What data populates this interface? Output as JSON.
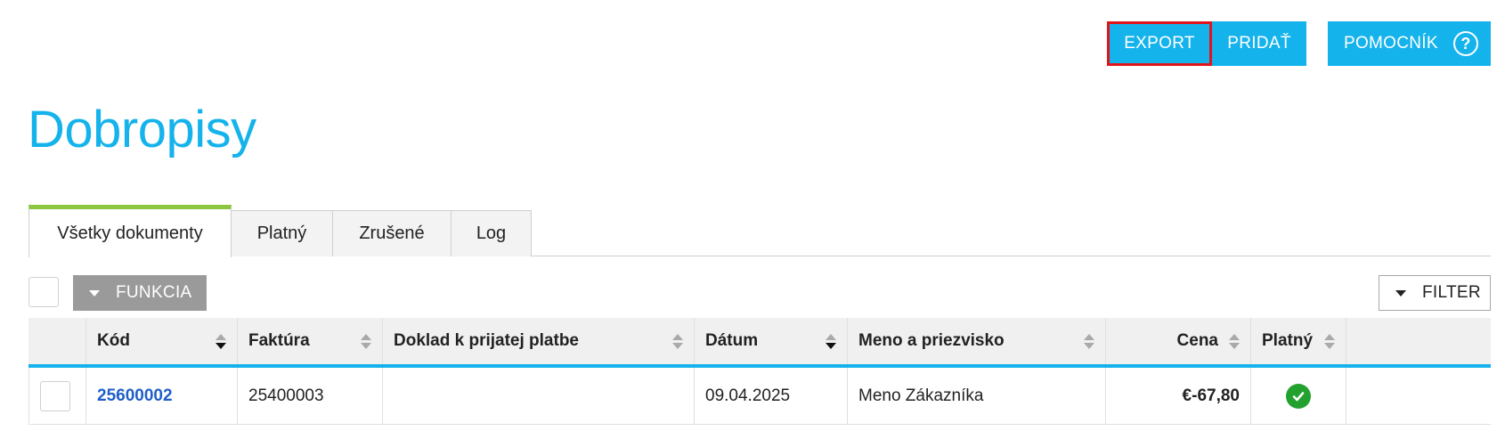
{
  "toolbar": {
    "export_label": "EXPORT",
    "add_label": "PRIDAŤ",
    "help_label": "POMOCNÍK",
    "help_glyph": "?",
    "accent_color": "#15b3ec"
  },
  "page": {
    "title": "Dobropisy"
  },
  "tabs": [
    {
      "label": "Všetky dokumenty",
      "active": true
    },
    {
      "label": "Platný",
      "active": false
    },
    {
      "label": "Zrušené",
      "active": false
    },
    {
      "label": "Log",
      "active": false
    }
  ],
  "actions": {
    "function_label": "FUNKCIA",
    "filter_label": "FILTER"
  },
  "table": {
    "headers": [
      "Kód",
      "Faktúra",
      "Doklad k prijatej platbe",
      "Dátum",
      "Meno a priezvisko",
      "Cena",
      "Platný"
    ],
    "rows": [
      {
        "code": "25600002",
        "invoice": "25400003",
        "payment_doc": "",
        "date": "09.04.2025",
        "name": "Meno Zákazníka",
        "price": "€-67,80",
        "valid_icon": "check-circle-icon"
      }
    ]
  }
}
